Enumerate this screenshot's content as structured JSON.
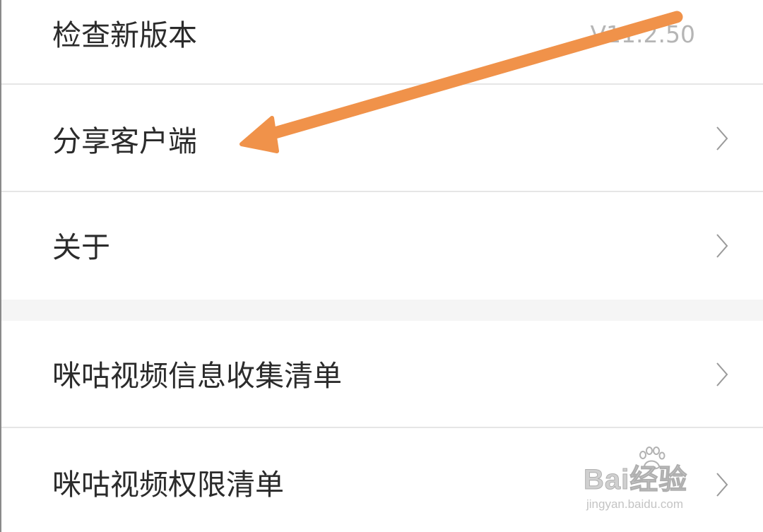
{
  "settings": {
    "rows": [
      {
        "label": "检查新版本",
        "value": "V11.2.50"
      },
      {
        "label": "分享客户端"
      },
      {
        "label": "关于"
      },
      {
        "label": "咪咕视频信息收集清单"
      },
      {
        "label": "咪咕视频权限清单"
      }
    ]
  },
  "watermark": {
    "brand": "Bai经验",
    "url": "jingyan.baidu.com"
  },
  "colors": {
    "arrow": "#f0924a",
    "label_text": "#2b2b2b",
    "value_text": "#b5b5b5",
    "divider": "#e6e6e6",
    "section_gap": "#f5f5f5"
  }
}
